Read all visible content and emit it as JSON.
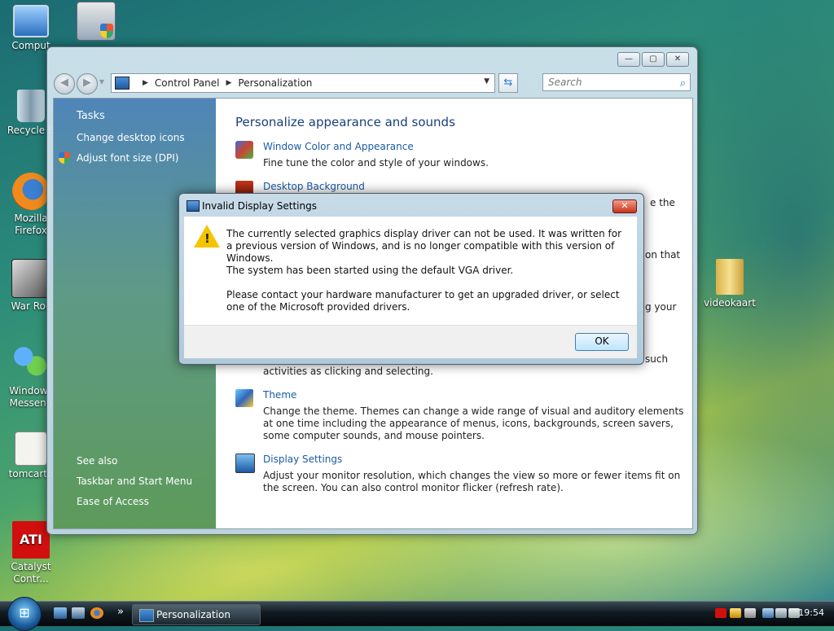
{
  "desktop": {
    "icons": [
      {
        "label": "Comput",
        "icon": "computer-icon"
      },
      {
        "label": "",
        "icon": "windows-update-icon"
      },
      {
        "label": "Recycle B",
        "icon": "recycle-bin-icon"
      },
      {
        "label": "Mozilla Firefox",
        "icon": "firefox-icon"
      },
      {
        "label": "War Roc",
        "icon": "war-rock-icon"
      },
      {
        "label": "Windows Messeng",
        "icon": "messenger-icon"
      },
      {
        "label": "tomcarto",
        "icon": "image-file-icon"
      },
      {
        "label": "Catalyst Contr...",
        "icon": "ati-catalyst-icon"
      },
      {
        "label": "videokaart",
        "icon": "folder-icon"
      }
    ]
  },
  "window": {
    "caption_buttons": {
      "minimize": "—",
      "maximize": "▢",
      "close": "✕"
    },
    "breadcrumb": [
      "Control Panel",
      "Personalization"
    ],
    "search_placeholder": "Search",
    "tasks": {
      "header": "Tasks",
      "links": [
        "Change desktop icons",
        "Adjust font size (DPI)"
      ],
      "see_also_header": "See also",
      "see_also_links": [
        "Taskbar and Start Menu",
        "Ease of Access"
      ]
    },
    "content": {
      "heading": "Personalize appearance and sounds",
      "items": [
        {
          "title": "Window Color and Appearance",
          "desc": "Fine tune the color and style of your windows."
        },
        {
          "title": "Desktop Background",
          "desc": "e the"
        },
        {
          "title": "",
          "desc": "on that"
        },
        {
          "title": "",
          "desc": "g your"
        },
        {
          "title": "",
          "desc": "activities as clicking and selecting.",
          "fragment": "such"
        },
        {
          "title": "Theme",
          "desc": "Change the theme. Themes can change a wide range of visual and auditory elements at one time including the appearance of menus, icons, backgrounds, screen savers, some computer sounds, and mouse pointers."
        },
        {
          "title": "Display Settings",
          "desc": "Adjust your monitor resolution, which changes the view so more or fewer items fit on the screen. You can also control monitor flicker (refresh rate)."
        }
      ]
    }
  },
  "dialog": {
    "title": "Invalid Display Settings",
    "close": "✕",
    "messages": [
      "The currently selected graphics display driver can not be used.  It was written for a previous version of Windows, and is no longer compatible with this version of Windows.",
      "The system has been started using the default VGA driver.",
      "Please contact your hardware manufacturer to get an upgraded driver, or select one of the Microsoft provided drivers."
    ],
    "ok_label": "OK"
  },
  "taskbar": {
    "start_glyph": "⊞",
    "more_glyph": "»",
    "task_label": "Personalization",
    "clock": "19:54"
  }
}
